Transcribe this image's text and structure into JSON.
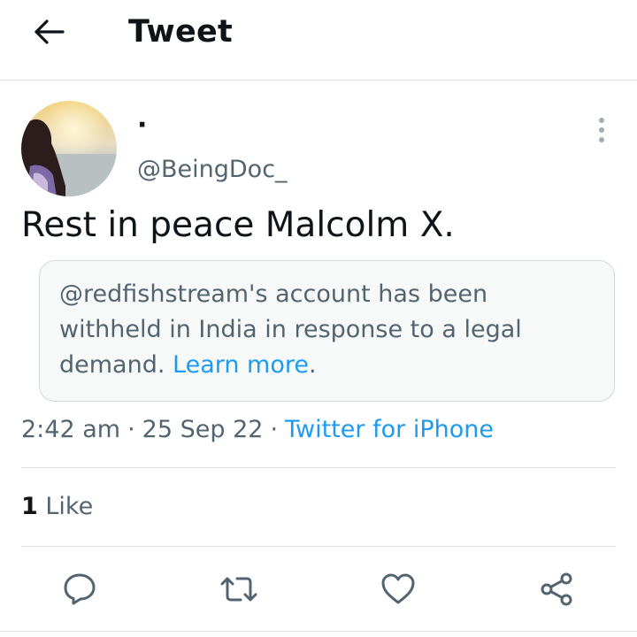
{
  "header": {
    "title": "Tweet",
    "back_icon": "arrow-left-icon"
  },
  "author": {
    "display_name": "·",
    "handle": "@BeingDoc_"
  },
  "tweet": {
    "text": "Rest in peace Malcolm X."
  },
  "notice": {
    "text": "@redfishstream's account has been withheld in India in response to a legal demand. ",
    "link_label": "Learn more",
    "trailing": "."
  },
  "meta": {
    "time": "2:42 am",
    "separator": "·",
    "date": "25 Sep 22",
    "source": "Twitter for iPhone"
  },
  "stats": {
    "like_count": "1",
    "like_label": "Like"
  },
  "actions": [
    "reply-icon",
    "retweet-icon",
    "like-icon",
    "share-icon"
  ],
  "colors": {
    "link": "#1d9bf0",
    "secondary_text": "#536471",
    "primary_text": "#0f1419",
    "border": "#dfe3e6"
  }
}
